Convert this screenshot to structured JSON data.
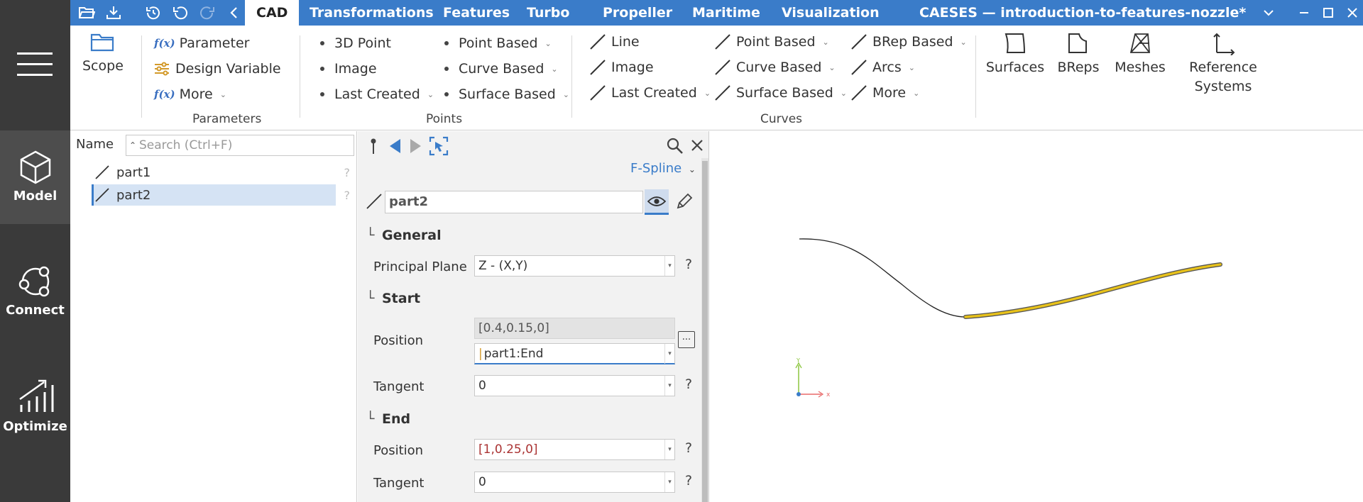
{
  "sidebar": {
    "items": [
      {
        "label": "Model",
        "icon": "cube-icon",
        "active": true
      },
      {
        "label": "Connect",
        "icon": "connect-icon",
        "active": false
      },
      {
        "label": "Optimize",
        "icon": "optimize-icon",
        "active": false
      }
    ]
  },
  "titlebar": {
    "tabs": [
      "CAD",
      "Transformations",
      "Features",
      "Turbo",
      "Propeller",
      "Maritime",
      "Visualization"
    ],
    "active_tab": "CAD",
    "app_title": "CAESES — introduction-to-features-nozzle*"
  },
  "ribbon": {
    "scope_label": "Scope",
    "parameters": {
      "items": [
        "Parameter",
        "Design Variable",
        "More"
      ],
      "group_label": "Parameters"
    },
    "points": {
      "col1": [
        "3D Point",
        "Image",
        "Last Created"
      ],
      "col2": [
        "Point Based",
        "Curve Based",
        "Surface Based"
      ],
      "group_label": "Points"
    },
    "curves": {
      "col1": [
        "Line",
        "Image",
        "Last Created"
      ],
      "col2": [
        "Point Based",
        "Curve Based",
        "Surface Based"
      ],
      "col3": [
        "BRep Based",
        "Arcs",
        "More"
      ],
      "group_label": "Curves"
    },
    "big_buttons": [
      "Surfaces",
      "BReps",
      "Meshes",
      "Reference Systems"
    ],
    "reference_line1": "Reference",
    "reference_line2": "Systems"
  },
  "tree": {
    "header": "Name",
    "search_placeholder": "Search (Ctrl+F)",
    "rows": [
      {
        "label": "part1",
        "selected": false
      },
      {
        "label": "part2",
        "selected": true
      }
    ],
    "help": "?"
  },
  "properties": {
    "type_label": "F-Spline",
    "name_value": "part2",
    "sections": {
      "general": "General",
      "start": "Start",
      "end": "End"
    },
    "labels": {
      "principal_plane": "Principal Plane",
      "position": "Position",
      "tangent": "Tangent"
    },
    "principal_plane_value": "Z - (X,Y)",
    "start_position_resolved": "[0.4,0.15,0]",
    "start_position_value": "part1:End",
    "start_tangent_value": "0",
    "end_position_value": "[1,0.25,0]",
    "end_tangent_value": "0",
    "help": "?",
    "ellipsis": "..."
  },
  "viewport": {
    "axis_y": "Y",
    "axis_x": "x",
    "highlight_color": "#e8c21a"
  }
}
